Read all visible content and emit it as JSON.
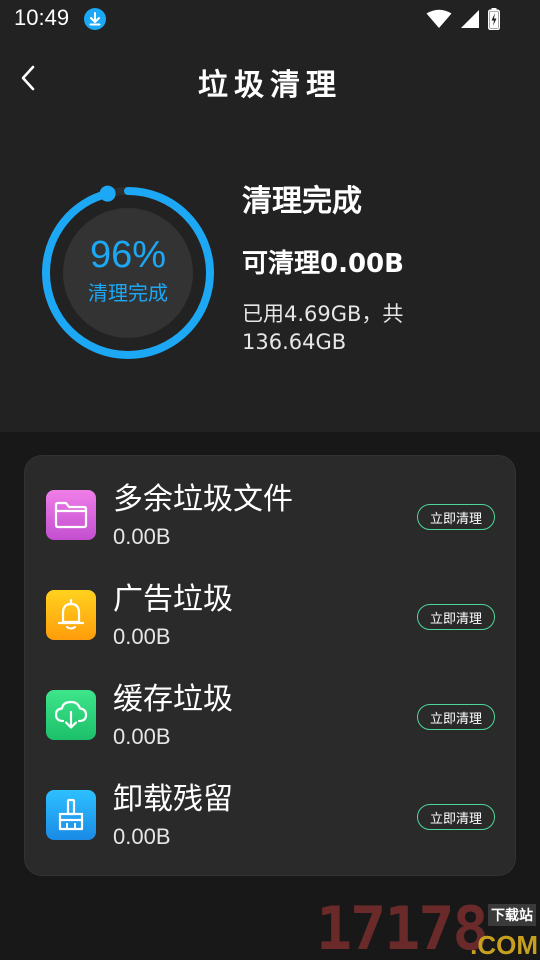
{
  "status_bar": {
    "time": "10:49"
  },
  "header": {
    "title": "垃圾清理"
  },
  "ring": {
    "percent_label": "96%",
    "percent_value": 96,
    "status_label": "清理完成",
    "color": "#1ca8f4"
  },
  "summary": {
    "title": "清理完成",
    "cleanable": "可清理0.00B",
    "usage": "已用4.69GB，共136.64GB"
  },
  "items": [
    {
      "title": "多余垃圾文件",
      "size": "0.00B",
      "button": "立即清理",
      "icon": "folder-icon",
      "color": "#e66ad8"
    },
    {
      "title": "广告垃圾",
      "size": "0.00B",
      "button": "立即清理",
      "icon": "bell-icon",
      "color": "#ffb20a"
    },
    {
      "title": "缓存垃圾",
      "size": "0.00B",
      "button": "立即清理",
      "icon": "cloud-download-icon",
      "color": "#2fd67c"
    },
    {
      "title": "卸载残留",
      "size": "0.00B",
      "button": "立即清理",
      "icon": "broom-icon",
      "color": "#1aa6f0"
    }
  ],
  "watermark": {
    "digits": "17178",
    "tag": "下载站",
    "domain": ".COM"
  },
  "colors": {
    "accent_blue": "#1ca8f4",
    "button_border": "#4ed69a",
    "top_background": "#222222",
    "card_background": "#2a2a2a"
  }
}
